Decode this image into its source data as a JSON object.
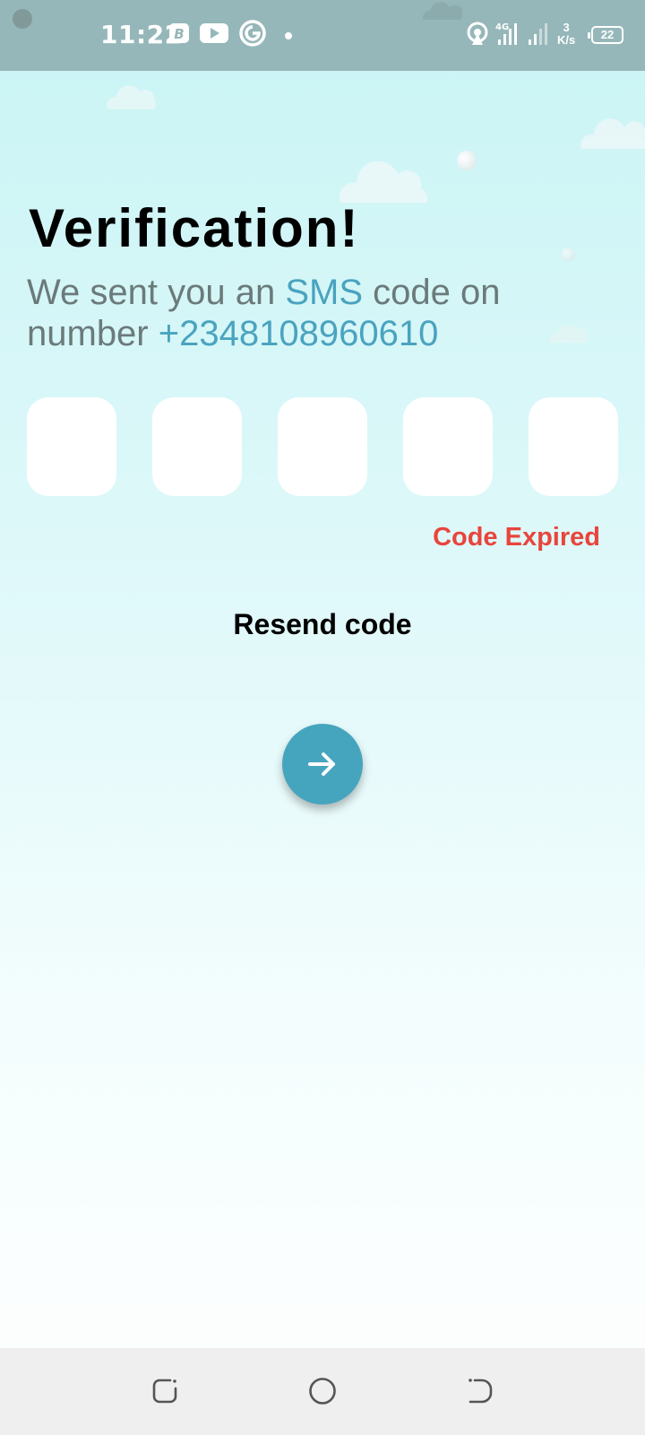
{
  "status_bar": {
    "time": "11:22",
    "speed_value": "3",
    "speed_unit": "K/s",
    "battery": "22",
    "icons": [
      "notification-b-icon",
      "youtube-icon",
      "g-app-icon",
      "hotspot-icon",
      "signal-4g-icon",
      "signal-icon"
    ]
  },
  "page": {
    "title": "Verification!",
    "subtitle_part1": "We sent you an ",
    "subtitle_sms": "SMS",
    "subtitle_part2": " code on number ",
    "phone_number": "+2348108960610",
    "code_boxes": [
      "",
      "",
      "",
      "",
      ""
    ],
    "status": "Code Expired",
    "resend_label": "Resend code"
  },
  "nav_bar": {
    "buttons": [
      "recent-apps",
      "home",
      "back"
    ]
  },
  "colors": {
    "accent": "#46a5be",
    "error": "#e8453c",
    "status_bar": "#96b7b9"
  }
}
